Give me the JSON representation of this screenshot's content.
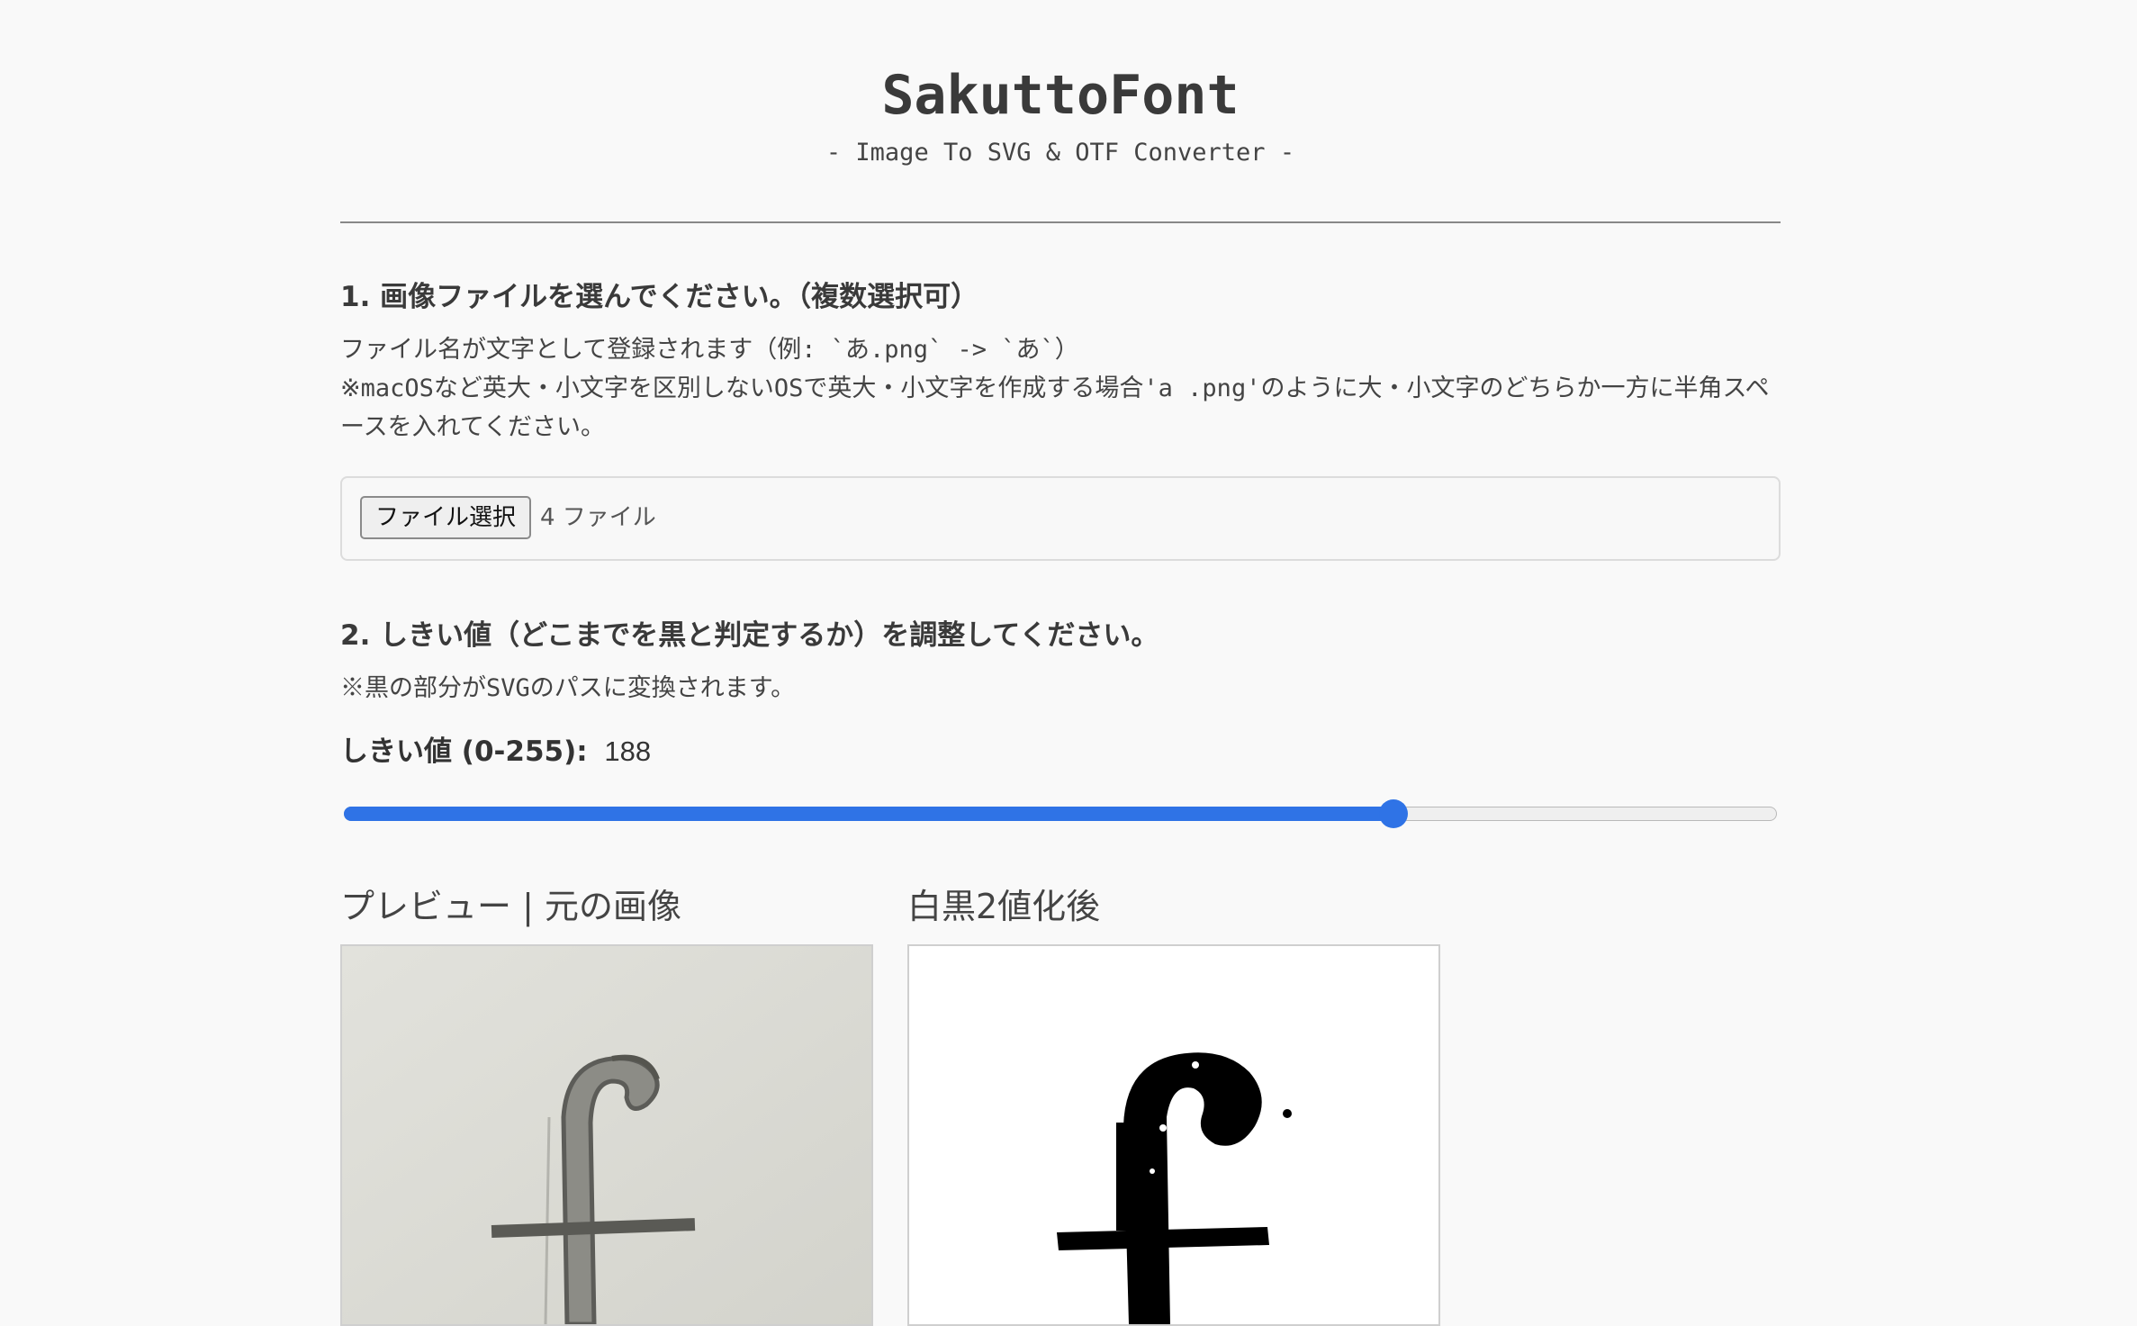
{
  "header": {
    "title": "SakuttoFont",
    "subtitle": "- Image To SVG & OTF Converter -"
  },
  "step1": {
    "heading": "1. 画像ファイルを選んでください。（複数選択可）",
    "note1": "ファイル名が文字として登録されます（例: `あ.png` -> `あ`）",
    "note2": "※macOSなど英大・小文字を区別しないOSで英大・小文字を作成する場合'a .png'のように大・小文字のどちらか一方に半角スペースを入れてください。",
    "file_button_label": "ファイル選択",
    "file_count": "4 ファイル"
  },
  "step2": {
    "heading": "2. しきい値（どこまでを黒と判定するか）を調整してください。",
    "note": "※黒の部分がSVGのパスに変換されます。",
    "threshold_label": "しきい値 (0-255):",
    "threshold_value": "188",
    "threshold_min": 0,
    "threshold_max": 255,
    "threshold_current": 188,
    "accent_color": "#2f73e6"
  },
  "preview": {
    "original_title": "プレビュー | 元の画像",
    "binary_title": "白黒2値化後",
    "original_icon": "handwritten-f-photo",
    "binary_icon": "binarized-f-image"
  }
}
